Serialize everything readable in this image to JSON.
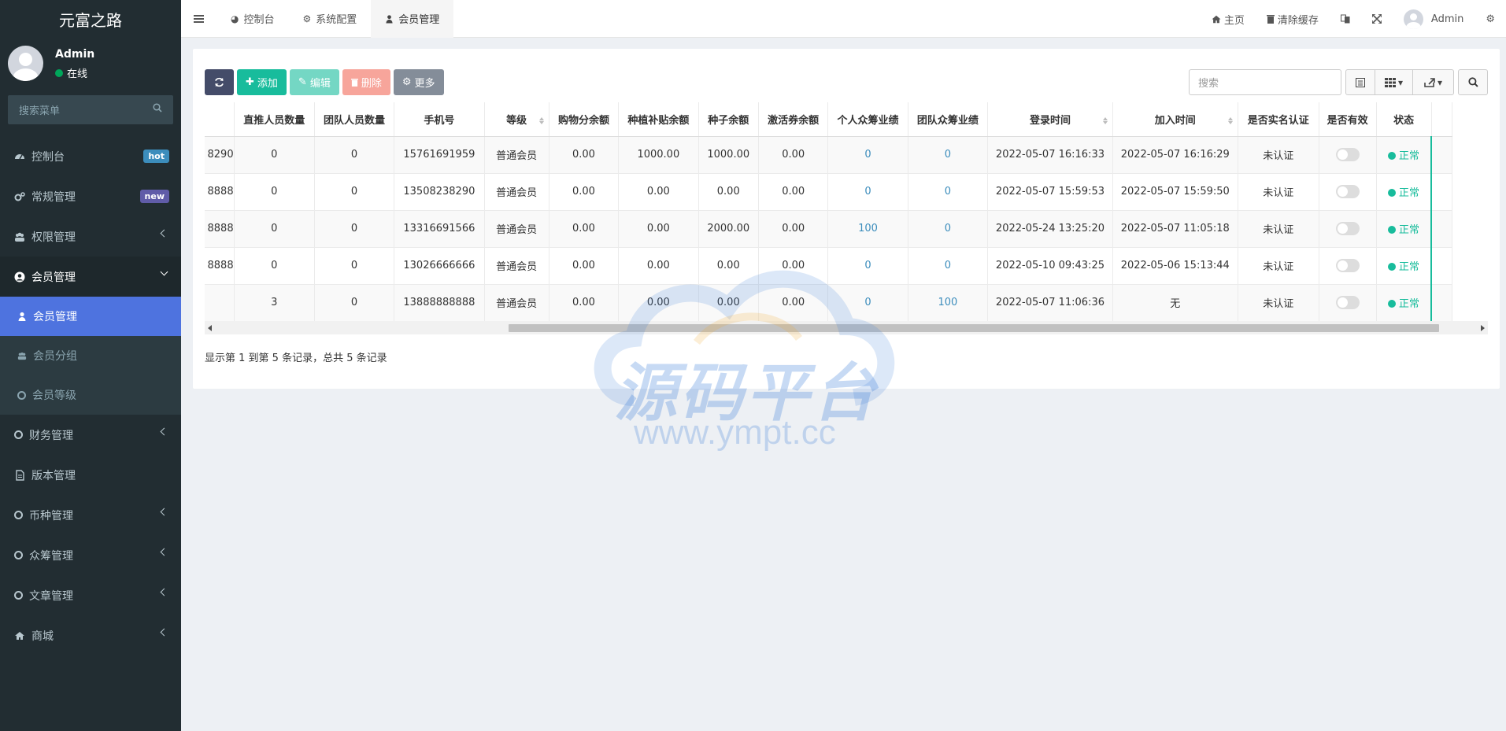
{
  "app": {
    "title": "元富之路"
  },
  "user": {
    "name": "Admin",
    "status": "在线"
  },
  "sidebar": {
    "search_placeholder": "搜索菜单",
    "items": [
      {
        "label": "控制台",
        "badge": "hot",
        "badge_color": "#3c8dbc"
      },
      {
        "label": "常规管理",
        "badge": "new",
        "badge_color": "#605ca8"
      },
      {
        "label": "权限管理"
      },
      {
        "label": "会员管理"
      },
      {
        "label": "财务管理"
      },
      {
        "label": "版本管理"
      },
      {
        "label": "币种管理"
      },
      {
        "label": "众筹管理"
      },
      {
        "label": "文章管理"
      },
      {
        "label": "商城"
      }
    ],
    "submenu": [
      {
        "label": "会员管理"
      },
      {
        "label": "会员分组"
      },
      {
        "label": "会员等级"
      }
    ]
  },
  "topbar": {
    "tabs": [
      {
        "label": "控制台",
        "icon": "dashboard-icon"
      },
      {
        "label": "系统配置",
        "icon": "gear-icon"
      },
      {
        "label": "会员管理",
        "icon": "user-icon"
      }
    ],
    "home_label": "主页",
    "clear_cache_label": "清除缓存",
    "admin_label": "Admin"
  },
  "toolbar": {
    "add_label": "添加",
    "edit_label": "编辑",
    "delete_label": "删除",
    "more_label": "更多",
    "search_placeholder": "搜索"
  },
  "table": {
    "columns": [
      "",
      "直推人员数量",
      "团队人员数量",
      "手机号",
      "等级",
      "购物分余额",
      "种植补贴余额",
      "种子余额",
      "激活券余额",
      "个人众筹业绩",
      "团队众筹业绩",
      "登录时间",
      "加入时间",
      "是否实名认证",
      "是否有效",
      "状态"
    ],
    "rows": [
      {
        "id": "8290",
        "direct": "0",
        "team": "0",
        "phone": "15761691959",
        "level": "普通会员",
        "shop": "0.00",
        "plant": "1000.00",
        "seed": "1000.00",
        "coupon": "0.00",
        "personal": "0",
        "team_perf": "0",
        "login": "2022-05-07 16:16:33",
        "join": "2022-05-07 16:16:29",
        "verified": "未认证",
        "status": "正常"
      },
      {
        "id": "8888",
        "direct": "0",
        "team": "0",
        "phone": "13508238290",
        "level": "普通会员",
        "shop": "0.00",
        "plant": "0.00",
        "seed": "0.00",
        "coupon": "0.00",
        "personal": "0",
        "team_perf": "0",
        "login": "2022-05-07 15:59:53",
        "join": "2022-05-07 15:59:50",
        "verified": "未认证",
        "status": "正常"
      },
      {
        "id": "8888",
        "direct": "0",
        "team": "0",
        "phone": "13316691566",
        "level": "普通会员",
        "shop": "0.00",
        "plant": "0.00",
        "seed": "2000.00",
        "coupon": "0.00",
        "personal": "100",
        "team_perf": "0",
        "login": "2022-05-24 13:25:20",
        "join": "2022-05-07 11:05:18",
        "verified": "未认证",
        "status": "正常"
      },
      {
        "id": "8888",
        "direct": "0",
        "team": "0",
        "phone": "13026666666",
        "level": "普通会员",
        "shop": "0.00",
        "plant": "0.00",
        "seed": "0.00",
        "coupon": "0.00",
        "personal": "0",
        "team_perf": "0",
        "login": "2022-05-10 09:43:25",
        "join": "2022-05-06 15:13:44",
        "verified": "未认证",
        "status": "正常"
      },
      {
        "id": "",
        "direct": "3",
        "team": "0",
        "phone": "13888888888",
        "level": "普通会员",
        "shop": "0.00",
        "plant": "0.00",
        "seed": "0.00",
        "coupon": "0.00",
        "personal": "0",
        "team_perf": "100",
        "login": "2022-05-07 11:06:36",
        "join": "无",
        "verified": "未认证",
        "status": "正常"
      }
    ]
  },
  "pagination": {
    "info": "显示第 1 到第 5 条记录，总共 5 条记录"
  },
  "watermark": {
    "text": "源码平台",
    "url": "www.ympt.cc"
  },
  "colors": {
    "accent": "#4e73df",
    "success": "#18bc9c",
    "link": "#3c8dbc",
    "sidebar_bg": "#222d32"
  }
}
